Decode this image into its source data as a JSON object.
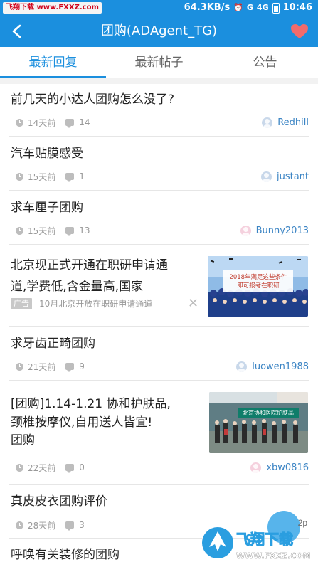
{
  "status_bar": {
    "left_badge": "飞翔下载 www.FXXZ.com",
    "network_speed": "64.3KB/s",
    "signal_1": "G",
    "signal_2": "4G",
    "time": "10:46"
  },
  "header": {
    "title": "团购(ADAgent_TG)",
    "back_icon": "chevron-left-icon",
    "favorite_icon": "heart-icon",
    "favorite_color": "#f26b6b",
    "bar_color": "#1b8fde"
  },
  "tabs": [
    {
      "label": "最新回复",
      "active": true
    },
    {
      "label": "最新帖子",
      "active": false
    },
    {
      "label": "公告",
      "active": false
    }
  ],
  "posts": [
    {
      "title": "前几天的小达人团购怎么没了?",
      "time": "14天前",
      "replies": "14",
      "author": "Redhill",
      "avatar": "blue"
    },
    {
      "title": "汽车贴膜感受",
      "time": "15天前",
      "replies": "1",
      "author": "justant",
      "avatar": "blue"
    },
    {
      "title": "求车厘子团购",
      "time": "15天前",
      "replies": "13",
      "author": "Bunny2013",
      "avatar": "pink"
    },
    {
      "title": "求牙齿正畸团购",
      "time": "21天前",
      "replies": "9",
      "author": "luowen1988",
      "avatar": "blue"
    },
    {
      "title_lines": [
        "[团购]1.14-1.21 协和护肤品,",
        "颈椎按摩仪,自用送人皆宜!",
        "团购"
      ],
      "time": "22天前",
      "replies": "0",
      "author": "xbw0816",
      "avatar": "pink",
      "image_text": "北京协和医院护肤品"
    },
    {
      "title": "真皮皮衣团购评价",
      "time": "28天前",
      "replies": "3"
    },
    {
      "title": "呼唤有关装修的团购"
    }
  ],
  "ad": {
    "title_lines": [
      "北京现正式开通在职研申请通",
      "道,学费低,含金量高,国家"
    ],
    "tag": "广告",
    "text": "10月北京开放在职研申请通道",
    "close": "✕",
    "banner_line1": "2018年满足这些条件",
    "banner_line2": "即可报考在职研"
  },
  "floating_count": "2p",
  "watermark": {
    "line1": "飞翔下载",
    "line2": "WWW.FXXZ.COM"
  }
}
